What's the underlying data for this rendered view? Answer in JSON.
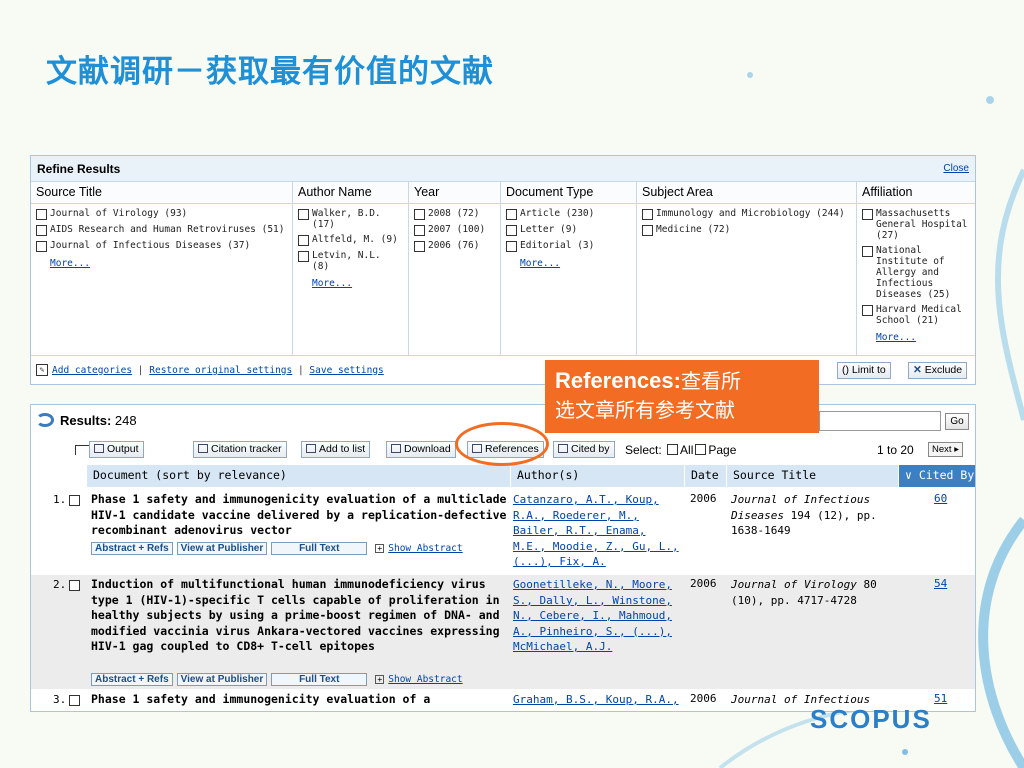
{
  "slide": {
    "title": "文献调研－获取最有价值的文献",
    "logo": "SCOPUS"
  },
  "refine": {
    "title": "Refine Results",
    "close": "Close",
    "columns": [
      {
        "header": "Source Title",
        "items": [
          "Journal of Virology (93)",
          "AIDS Research and Human Retroviruses (51)",
          "Journal of Infectious Diseases (37)"
        ],
        "more": "More..."
      },
      {
        "header": "Author Name",
        "items": [
          "Walker, B.D. (17)",
          "Altfeld, M. (9)",
          "Letvin, N.L. (8)"
        ],
        "more": "More..."
      },
      {
        "header": "Year",
        "items": [
          "2008 (72)",
          "2007 (100)",
          "2006 (76)"
        ],
        "more": ""
      },
      {
        "header": "Document Type",
        "items": [
          "Article (230)",
          "Letter (9)",
          "Editorial (3)"
        ],
        "more": "More..."
      },
      {
        "header": "Subject Area",
        "items": [
          "Immunology and Microbiology (244)",
          "Medicine (72)"
        ],
        "more": ""
      },
      {
        "header": "Affiliation",
        "items": [
          "Massachusetts General Hospital (27)",
          "National Institute of Allergy and Infectious Diseases (25)",
          "Harvard Medical School (21)"
        ],
        "more": "More..."
      }
    ],
    "footer": {
      "add": "Add categories",
      "restore": "Restore original settings",
      "save": "Save settings"
    },
    "limit": "() Limit to",
    "exclude": "Exclude"
  },
  "callout": {
    "bold": "References:",
    "line1": "查看所",
    "line2": "选文章所有参考文献"
  },
  "results": {
    "label": "Results:",
    "count": "248",
    "go": "Go",
    "toolbar": {
      "output": "Output",
      "citation_tracker": "Citation tracker",
      "add_to_list": "Add to list",
      "download": "Download",
      "references": "References",
      "cited_by": "Cited by",
      "select": "Select:",
      "all": "All",
      "page": "Page",
      "range": "1 to 20",
      "next": "Next"
    },
    "columns": [
      "Document (sort by relevance)",
      "Author(s)",
      "Date",
      "Source Title",
      "Cited By"
    ],
    "link_labels": {
      "abstract": "Abstract + Refs",
      "publisher": "View at Publisher",
      "full_text": "Full Text",
      "show_abstract": "Show Abstract"
    },
    "rows": [
      {
        "num": "1.",
        "title": "Phase 1 safety and immunogenicity evaluation of a multiclade HIV-1 candidate vaccine delivered by a replication-defective recombinant adenovirus vector",
        "authors": "Catanzaro, A.T., Koup, R.A., Roederer, M., Bailer, R.T., Enama, M.E., Moodie, Z., Gu, L., (...), Fix, A.",
        "date": "2006",
        "source_journal": "Journal of Infectious Diseases",
        "source_rest": "194 (12), pp. 1638-1649",
        "cited": "60"
      },
      {
        "num": "2.",
        "title": "Induction of multifunctional human immunodeficiency virus type 1 (HIV-1)-specific T cells capable of proliferation in healthy subjects by using a prime-boost regimen of DNA- and modified vaccinia virus Ankara-vectored vaccines expressing HIV-1 gag coupled to CD8+ T-cell epitopes",
        "authors": "Goonetilleke, N., Moore, S., Dally, L., Winstone, N., Cebere, I., Mahmoud, A., Pinheiro, S., (...), McMichael, A.J.",
        "date": "2006",
        "source_journal": "Journal of Virology",
        "source_rest": "80 (10), pp. 4717-4728",
        "cited": "54"
      },
      {
        "num": "3.",
        "title": "Phase 1 safety and immunogenicity evaluation of a",
        "authors": "Graham, B.S., Koup, R.A.,",
        "date": "2006",
        "source_journal": "Journal of Infectious",
        "source_rest": "",
        "cited": "51"
      }
    ]
  }
}
